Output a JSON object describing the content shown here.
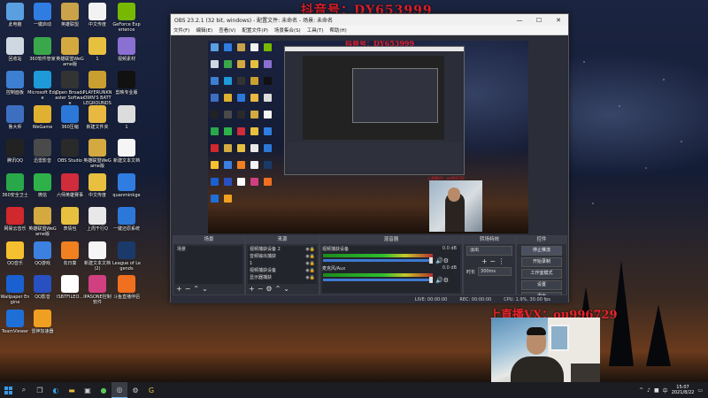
{
  "watermark": {
    "top": "抖音号：DY653999",
    "vx": "上直播VX：ou996729",
    "mini_top": "抖音号：DY653999",
    "mini_vx": "上直播VX：ou996729"
  },
  "desktop_icons": [
    {
      "label": "此电脑",
      "color": "#5aa0e0"
    },
    {
      "label": "一键启动",
      "color": "#2f7de0"
    },
    {
      "label": "英雄联盟",
      "color": "#c9a24a"
    },
    {
      "label": "中文传度",
      "color": "#f2f2f2"
    },
    {
      "label": "GeForce Experience",
      "color": "#76b900"
    },
    {
      "label": "回收站",
      "color": "#cfd8e0"
    },
    {
      "label": "360软件管家",
      "color": "#3aa84a"
    },
    {
      "label": "英雄联盟WeGame版",
      "color": "#d4aa40"
    },
    {
      "label": "1",
      "color": "#e8c040"
    },
    {
      "label": "视频素材",
      "color": "#8a70d0"
    },
    {
      "label": "控制面板",
      "color": "#3d7fd0"
    },
    {
      "label": "Microsoft Edge",
      "color": "#1e9ad8"
    },
    {
      "label": "Open Broadcaster Software",
      "color": "#333333"
    },
    {
      "label": "PLAYERUNKNOWN'S BATTLEGROUNDS",
      "color": "#c9a030"
    },
    {
      "label": "剪映专业版",
      "color": "#111111"
    },
    {
      "label": "鲁大师",
      "color": "#3c6fc0"
    },
    {
      "label": "WeGame",
      "color": "#e0b030"
    },
    {
      "label": "360压缩",
      "color": "#2c78d8"
    },
    {
      "label": "新建文件夹",
      "color": "#e8b840"
    },
    {
      "label": "1",
      "color": "#dcdcdc"
    },
    {
      "label": "腾讯QQ",
      "color": "#222222"
    },
    {
      "label": "迅雷影音",
      "color": "#4a4a4a"
    },
    {
      "label": "OBS Studio",
      "color": "#2a2a2a"
    },
    {
      "label": "英雄联盟WeGame版",
      "color": "#d4aa40"
    },
    {
      "label": "新建文本文档",
      "color": "#f5f5f5"
    },
    {
      "label": "360安全卫士",
      "color": "#29a84a"
    },
    {
      "label": "微信",
      "color": "#2fb14a"
    },
    {
      "label": "六师英雄赛事",
      "color": "#d02c3c"
    },
    {
      "label": "中文传度",
      "color": "#e8c040"
    },
    {
      "label": "quanminkge",
      "color": "#2f7de0"
    },
    {
      "label": "网易云音乐",
      "color": "#d0282c"
    },
    {
      "label": "英雄联盟WeGame版",
      "color": "#d4aa40"
    },
    {
      "label": "表情包",
      "color": "#e8c040"
    },
    {
      "label": "上周千行Q",
      "color": "#e8e8e8"
    },
    {
      "label": "一键还原系统",
      "color": "#2c78d8"
    },
    {
      "label": "QQ音乐",
      "color": "#f5c030"
    },
    {
      "label": "QQ游戏",
      "color": "#3c80e0"
    },
    {
      "label": "向日葵",
      "color": "#f08020"
    },
    {
      "label": "新建文本文档 (2)",
      "color": "#f5f5f5"
    },
    {
      "label": "League of Legends",
      "color": "#1a3a6a"
    },
    {
      "label": "Wallpaper Engine",
      "color": "#1a60d0"
    },
    {
      "label": "QQ影音",
      "color": "#2850c0"
    },
    {
      "label": "ISBTFILEO...",
      "color": "#ffffff"
    },
    {
      "label": "IPASONE控制软件",
      "color": "#d04080"
    },
    {
      "label": "斗鱼直播伴侣",
      "color": "#f07020"
    },
    {
      "label": "TeamViewer",
      "color": "#1e6fd8"
    },
    {
      "label": "雷神加速器",
      "color": "#f0a020"
    }
  ],
  "obs": {
    "title": "OBS 23.2.1 (32 bit, windows) - 配置文件: 未命名 - 场景: 未命名",
    "menu": [
      "文件(F)",
      "编辑(E)",
      "查看(V)",
      "配置文件(P)",
      "场景集合(S)",
      "工具(T)",
      "帮助(H)"
    ],
    "docks": {
      "scenes": {
        "title": "场景",
        "items": [
          "场景"
        ]
      },
      "sources": {
        "title": "来源",
        "items": [
          "视频捕获设备 2",
          "音频输出捕获",
          "1",
          "视频捕获设备",
          "显示器捕获"
        ]
      },
      "mixer": {
        "title": "混音器",
        "items": [
          {
            "name": "视频捕获设备",
            "db": "0.0 dB"
          },
          {
            "name": "麦克风/Aux",
            "db": "0.0 dB"
          }
        ]
      },
      "transitions": {
        "title": "转场特效",
        "select": "淡出",
        "duration_label": "时长",
        "duration": "300ms"
      },
      "controls": {
        "title": "控件",
        "buttons": [
          "停止推流",
          "开始录制",
          "工作室模式",
          "设置",
          "退出"
        ]
      }
    },
    "status": {
      "live": "LIVE: 00:00:00",
      "rec": "REC: 00:00:00",
      "cpu": "CPU: 1.9%, 30.00 fps"
    }
  },
  "taskbar": {
    "time": "15:07",
    "date": "2021/8/22",
    "tray_lang": "中",
    "tray_icons": [
      "^",
      "♪",
      "■",
      "中"
    ]
  }
}
